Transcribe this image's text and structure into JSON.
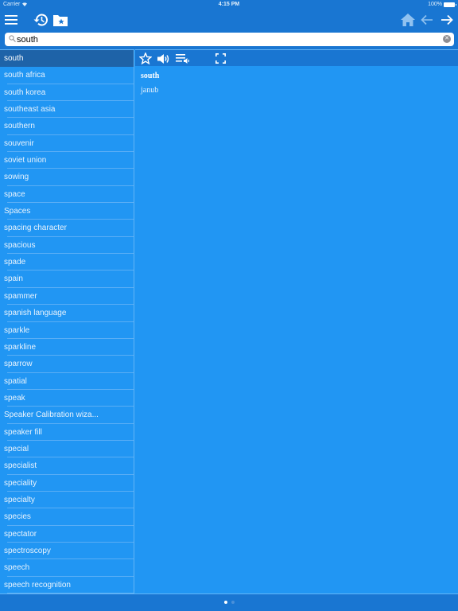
{
  "status_bar": {
    "carrier": "Carrier",
    "time": "4:15 PM",
    "battery": "100%"
  },
  "nav": {
    "menu_icon": "hamburger-menu-icon",
    "history_icon": "history-icon",
    "bookmarks_icon": "bookmark-folder-icon",
    "home_icon": "home-icon",
    "back_icon": "arrow-left-icon",
    "forward_icon": "arrow-right-icon"
  },
  "search": {
    "value": "south",
    "placeholder": ""
  },
  "word_list": [
    "south",
    "south africa",
    "south korea",
    "southeast asia",
    "southern",
    "souvenir",
    "soviet union",
    "sowing",
    "space",
    "Spaces",
    "spacing character",
    "spacious",
    "spade",
    "spain",
    "spammer",
    "spanish language",
    "sparkle",
    "sparkline",
    "sparrow",
    "spatial",
    "speak",
    "Speaker Calibration wiza...",
    "speaker fill",
    "special",
    "specialist",
    "speciality",
    "specialty",
    "species",
    "spectator",
    "spectroscopy",
    "speech",
    "speech recognition"
  ],
  "selected_index": 0,
  "detail": {
    "headword": "south",
    "translation": "janub",
    "toolbar": [
      "star-icon",
      "speaker-icon",
      "playlist-audio-icon",
      "fullscreen-icon"
    ]
  },
  "pager": {
    "pages": 2,
    "current": 1
  },
  "colors": {
    "bar": "#1976d2",
    "content": "#2196f3",
    "selected": "#1e63a8"
  }
}
